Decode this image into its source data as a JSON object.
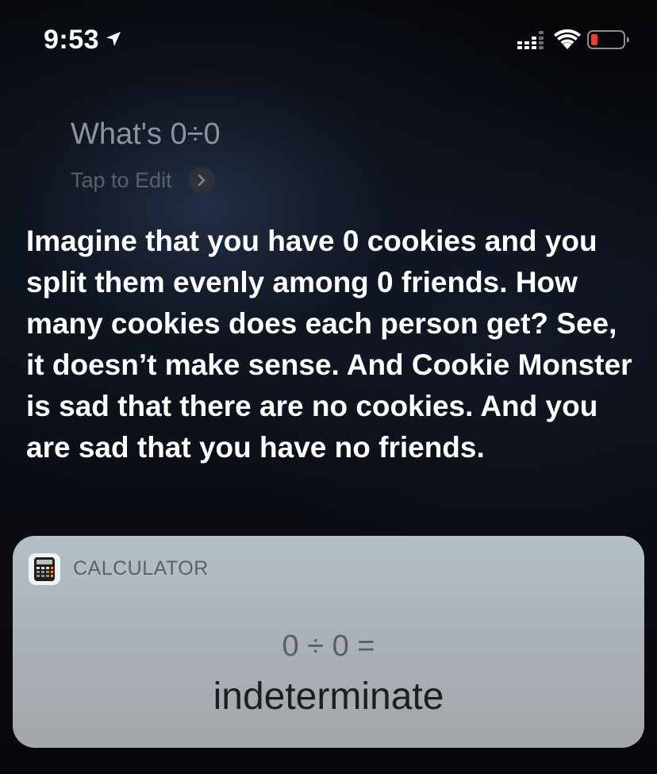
{
  "status_bar": {
    "time": "9:53",
    "icons": [
      "location-arrow-icon",
      "cellular-signal-icon",
      "wifi-icon",
      "battery-low-icon"
    ],
    "battery_color": "#ff3b30"
  },
  "siri": {
    "query": "What's 0÷0",
    "tap_to_edit": "Tap to Edit",
    "response": "Imagine that you have 0 cookies and you split them evenly among 0 friends. How many cookies does each person get? See, it doesn’t make sense. And Cookie Monster is sad that there are no cookies. And you are sad that you have no friends."
  },
  "calculator_card": {
    "app_name": "CALCULATOR",
    "app_icon": "calculator-icon",
    "expression": "0 ÷ 0 =",
    "result": "indeterminate"
  }
}
